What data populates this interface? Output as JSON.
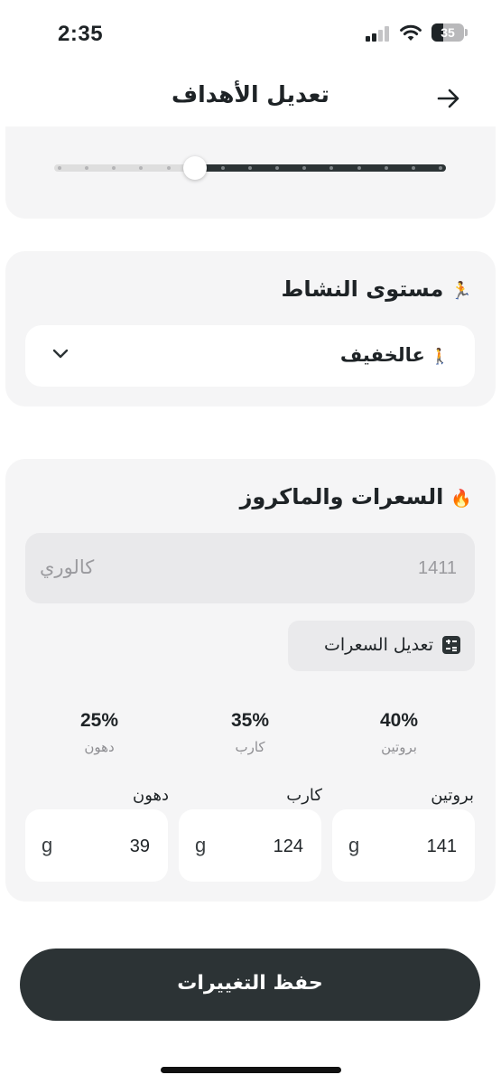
{
  "status_bar": {
    "time": "2:35",
    "battery_level": "35",
    "battery_fraction": 0.35
  },
  "header": {
    "title": "تعديل الأهداف",
    "back_icon": "arrow-right-icon"
  },
  "goal_slider": {
    "fraction": 0.36,
    "tick_count": 15,
    "active_color": "#2c3335",
    "rail_color": "#dedede"
  },
  "activity": {
    "title": "مستوى النشاط",
    "title_emoji": "🏃",
    "selected_emoji": "🚶",
    "selected_value": "عالخفيف",
    "chevron_icon": "chevron-down-icon"
  },
  "macros": {
    "title": "السعرات والماكروز",
    "title_emoji": "🔥",
    "calories_value": "1411",
    "calories_unit": "كالوري",
    "edit_calories_label": "تعديل السعرات",
    "edit_calories_icon": "calculator-icon",
    "percentages": [
      {
        "value": "40%",
        "label": "بروتين"
      },
      {
        "value": "35%",
        "label": "كارب"
      },
      {
        "value": "25%",
        "label": "دهون"
      }
    ],
    "inputs": [
      {
        "label": "بروتين",
        "value": "141",
        "unit": "g"
      },
      {
        "label": "كارب",
        "value": "124",
        "unit": "g"
      },
      {
        "label": "دهون",
        "value": "39",
        "unit": "g"
      }
    ]
  },
  "save_button": {
    "label": "حفظ التغييرات"
  },
  "colors": {
    "primary": "#2c3335",
    "card_background": "#f5f5f6",
    "muted_text": "#8e8e92"
  }
}
